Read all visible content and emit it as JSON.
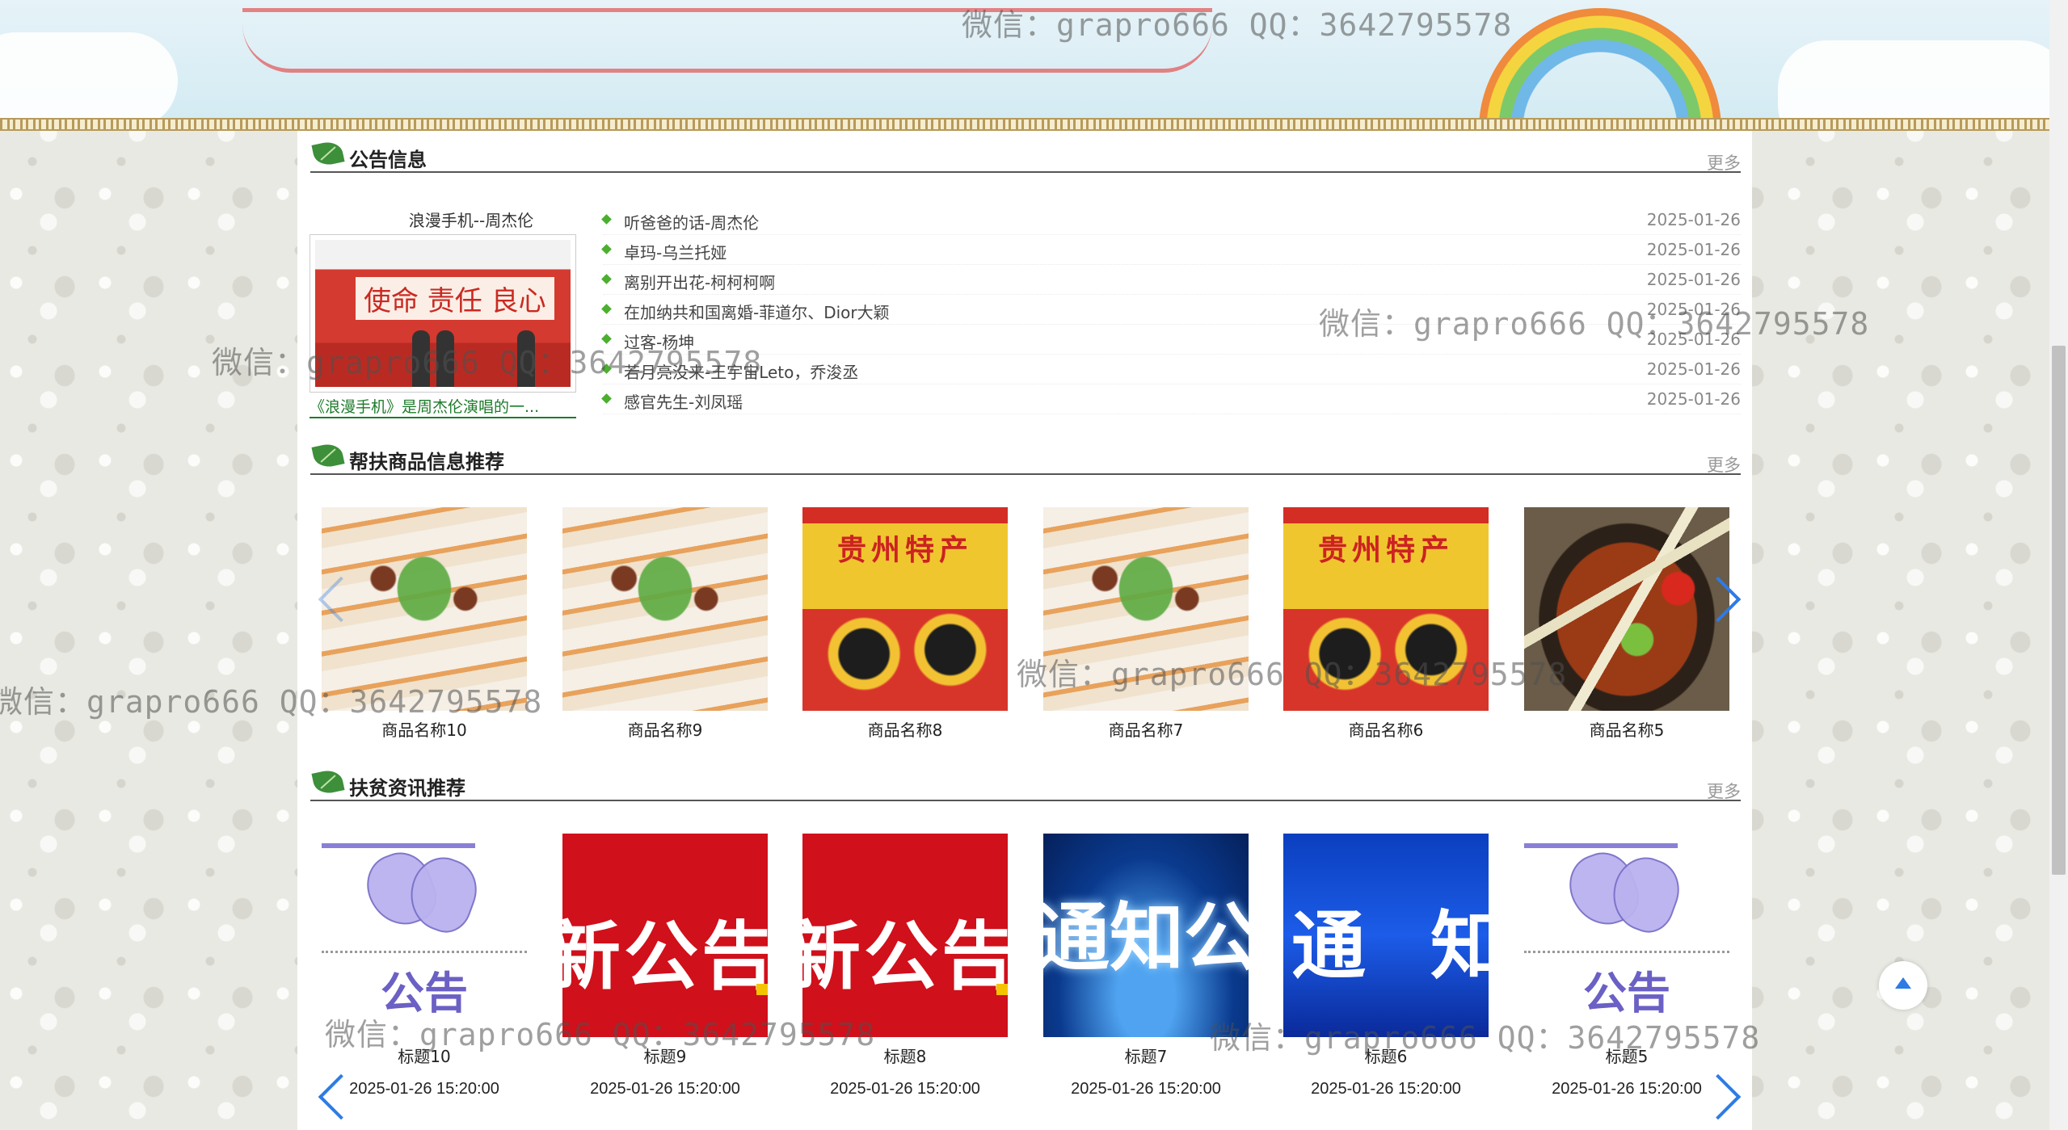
{
  "announcements": {
    "title": "公告信息",
    "more": "更多",
    "feature": {
      "title": "浪漫手机--周杰伦",
      "caption": "《浪漫手机》是周杰伦演唱的一...",
      "image_text": "使命 责任 良心"
    },
    "items": [
      {
        "text": "听爸爸的话-周杰伦",
        "date": "2025-01-26"
      },
      {
        "text": "卓玛-乌兰托娅",
        "date": "2025-01-26"
      },
      {
        "text": "离别开出花-柯柯柯啊",
        "date": "2025-01-26"
      },
      {
        "text": "在加纳共和国离婚-菲道尔、Dior大颖",
        "date": "2025-01-26"
      },
      {
        "text": "过客-杨坤",
        "date": "2025-01-26"
      },
      {
        "text": "若月亮没来-王宇宙Leto，乔浚丞",
        "date": "2025-01-26"
      },
      {
        "text": "感官先生-刘凤瑶",
        "date": "2025-01-26"
      }
    ]
  },
  "products": {
    "title": "帮扶商品信息推荐",
    "more": "更多",
    "items": [
      {
        "name": "商品名称10",
        "image": "noodle"
      },
      {
        "name": "商品名称9",
        "image": "noodle"
      },
      {
        "name": "商品名称8",
        "image": "giftbox"
      },
      {
        "name": "商品名称7",
        "image": "noodle"
      },
      {
        "name": "商品名称6",
        "image": "giftbox"
      },
      {
        "name": "商品名称5",
        "image": "hotpot"
      }
    ],
    "giftbox_label": "贵州特产"
  },
  "news": {
    "title": "扶贫资讯推荐",
    "more": "更多",
    "items": [
      {
        "title": "标题10",
        "time": "2025-01-26 15:20:00",
        "image": "butterfly"
      },
      {
        "title": "标题9",
        "time": "2025-01-26 15:20:00",
        "image": "red"
      },
      {
        "title": "标题8",
        "time": "2025-01-26 15:20:00",
        "image": "red"
      },
      {
        "title": "标题7",
        "time": "2025-01-26 15:20:00",
        "image": "blue"
      },
      {
        "title": "标题6",
        "time": "2025-01-26 15:20:00",
        "image": "blue2"
      },
      {
        "title": "标题5",
        "time": "2025-01-26 15:20:00",
        "image": "butterfly"
      }
    ],
    "img_text": {
      "butterfly": "公告",
      "red": "新公告",
      "blue": "通知公告",
      "blue2": "通 知"
    }
  },
  "watermark": "微信：grapro666 QQ：3642795578",
  "colors": {
    "accent": "#2d7be5",
    "leaf": "#3d8f3a",
    "caption_link": "#1e7a2a"
  }
}
